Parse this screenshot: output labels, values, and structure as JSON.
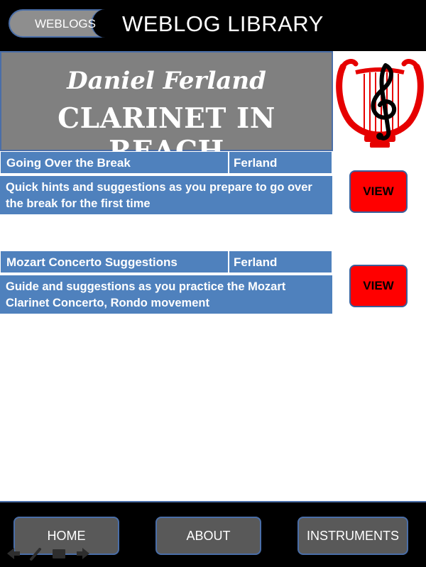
{
  "header": {
    "weblogs_button": "WEBLOGS",
    "title": "WEBLOG LIBRARY"
  },
  "banner": {
    "author": "Daniel Ferland",
    "title": "CLARINET IN REACH",
    "logo_icon": "lyre-treble-clef-icon"
  },
  "entries": [
    {
      "title": "Going Over the Break",
      "author": "Ferland",
      "description": "Quick hints and suggestions as you prepare to go over the break for the first time",
      "view_label": "VIEW"
    },
    {
      "title": "Mozart Concerto Suggestions",
      "author": "Ferland",
      "description": "Guide and suggestions as you practice the Mozart Clarinet Concerto, Rondo movement",
      "view_label": "VIEW"
    }
  ],
  "footer": {
    "home": "HOME",
    "about": "ABOUT",
    "instruments": "INSTRUMENTS"
  },
  "slideshow_tools": [
    "arrow-left-icon",
    "pen-icon",
    "slides-icon",
    "arrow-right-icon"
  ],
  "colors": {
    "row_blue": "#4f81bd",
    "view_red": "#ff0000",
    "banner_gray": "#808080",
    "bar_black": "#000000"
  }
}
